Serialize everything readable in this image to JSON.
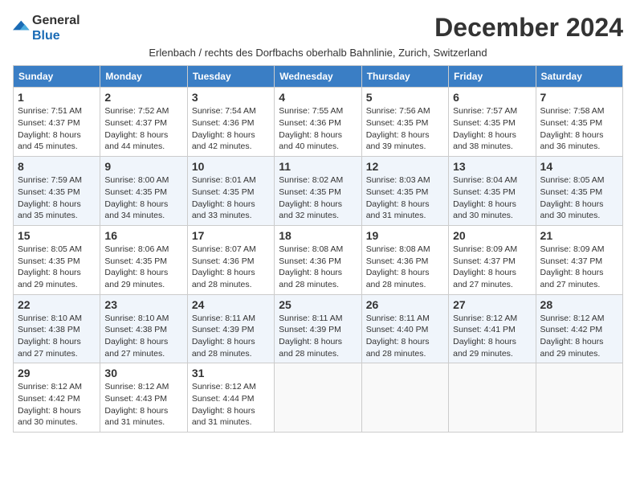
{
  "logo": {
    "text_general": "General",
    "text_blue": "Blue"
  },
  "header": {
    "month_title": "December 2024",
    "subtitle": "Erlenbach / rechts des Dorfbachs oberhalb Bahnlinie, Zurich, Switzerland"
  },
  "days_of_week": [
    "Sunday",
    "Monday",
    "Tuesday",
    "Wednesday",
    "Thursday",
    "Friday",
    "Saturday"
  ],
  "weeks": [
    {
      "days": [
        {
          "num": "1",
          "sunrise": "7:51 AM",
          "sunset": "4:37 PM",
          "daylight": "8 hours and 45 minutes."
        },
        {
          "num": "2",
          "sunrise": "7:52 AM",
          "sunset": "4:37 PM",
          "daylight": "8 hours and 44 minutes."
        },
        {
          "num": "3",
          "sunrise": "7:54 AM",
          "sunset": "4:36 PM",
          "daylight": "8 hours and 42 minutes."
        },
        {
          "num": "4",
          "sunrise": "7:55 AM",
          "sunset": "4:36 PM",
          "daylight": "8 hours and 40 minutes."
        },
        {
          "num": "5",
          "sunrise": "7:56 AM",
          "sunset": "4:35 PM",
          "daylight": "8 hours and 39 minutes."
        },
        {
          "num": "6",
          "sunrise": "7:57 AM",
          "sunset": "4:35 PM",
          "daylight": "8 hours and 38 minutes."
        },
        {
          "num": "7",
          "sunrise": "7:58 AM",
          "sunset": "4:35 PM",
          "daylight": "8 hours and 36 minutes."
        }
      ]
    },
    {
      "days": [
        {
          "num": "8",
          "sunrise": "7:59 AM",
          "sunset": "4:35 PM",
          "daylight": "8 hours and 35 minutes."
        },
        {
          "num": "9",
          "sunrise": "8:00 AM",
          "sunset": "4:35 PM",
          "daylight": "8 hours and 34 minutes."
        },
        {
          "num": "10",
          "sunrise": "8:01 AM",
          "sunset": "4:35 PM",
          "daylight": "8 hours and 33 minutes."
        },
        {
          "num": "11",
          "sunrise": "8:02 AM",
          "sunset": "4:35 PM",
          "daylight": "8 hours and 32 minutes."
        },
        {
          "num": "12",
          "sunrise": "8:03 AM",
          "sunset": "4:35 PM",
          "daylight": "8 hours and 31 minutes."
        },
        {
          "num": "13",
          "sunrise": "8:04 AM",
          "sunset": "4:35 PM",
          "daylight": "8 hours and 30 minutes."
        },
        {
          "num": "14",
          "sunrise": "8:05 AM",
          "sunset": "4:35 PM",
          "daylight": "8 hours and 30 minutes."
        }
      ]
    },
    {
      "days": [
        {
          "num": "15",
          "sunrise": "8:05 AM",
          "sunset": "4:35 PM",
          "daylight": "8 hours and 29 minutes."
        },
        {
          "num": "16",
          "sunrise": "8:06 AM",
          "sunset": "4:35 PM",
          "daylight": "8 hours and 29 minutes."
        },
        {
          "num": "17",
          "sunrise": "8:07 AM",
          "sunset": "4:36 PM",
          "daylight": "8 hours and 28 minutes."
        },
        {
          "num": "18",
          "sunrise": "8:08 AM",
          "sunset": "4:36 PM",
          "daylight": "8 hours and 28 minutes."
        },
        {
          "num": "19",
          "sunrise": "8:08 AM",
          "sunset": "4:36 PM",
          "daylight": "8 hours and 28 minutes."
        },
        {
          "num": "20",
          "sunrise": "8:09 AM",
          "sunset": "4:37 PM",
          "daylight": "8 hours and 27 minutes."
        },
        {
          "num": "21",
          "sunrise": "8:09 AM",
          "sunset": "4:37 PM",
          "daylight": "8 hours and 27 minutes."
        }
      ]
    },
    {
      "days": [
        {
          "num": "22",
          "sunrise": "8:10 AM",
          "sunset": "4:38 PM",
          "daylight": "8 hours and 27 minutes."
        },
        {
          "num": "23",
          "sunrise": "8:10 AM",
          "sunset": "4:38 PM",
          "daylight": "8 hours and 27 minutes."
        },
        {
          "num": "24",
          "sunrise": "8:11 AM",
          "sunset": "4:39 PM",
          "daylight": "8 hours and 28 minutes."
        },
        {
          "num": "25",
          "sunrise": "8:11 AM",
          "sunset": "4:39 PM",
          "daylight": "8 hours and 28 minutes."
        },
        {
          "num": "26",
          "sunrise": "8:11 AM",
          "sunset": "4:40 PM",
          "daylight": "8 hours and 28 minutes."
        },
        {
          "num": "27",
          "sunrise": "8:12 AM",
          "sunset": "4:41 PM",
          "daylight": "8 hours and 29 minutes."
        },
        {
          "num": "28",
          "sunrise": "8:12 AM",
          "sunset": "4:42 PM",
          "daylight": "8 hours and 29 minutes."
        }
      ]
    },
    {
      "days": [
        {
          "num": "29",
          "sunrise": "8:12 AM",
          "sunset": "4:42 PM",
          "daylight": "8 hours and 30 minutes."
        },
        {
          "num": "30",
          "sunrise": "8:12 AM",
          "sunset": "4:43 PM",
          "daylight": "8 hours and 31 minutes."
        },
        {
          "num": "31",
          "sunrise": "8:12 AM",
          "sunset": "4:44 PM",
          "daylight": "8 hours and 31 minutes."
        },
        null,
        null,
        null,
        null
      ]
    }
  ],
  "labels": {
    "sunrise": "Sunrise:",
    "sunset": "Sunset:",
    "daylight": "Daylight:"
  }
}
